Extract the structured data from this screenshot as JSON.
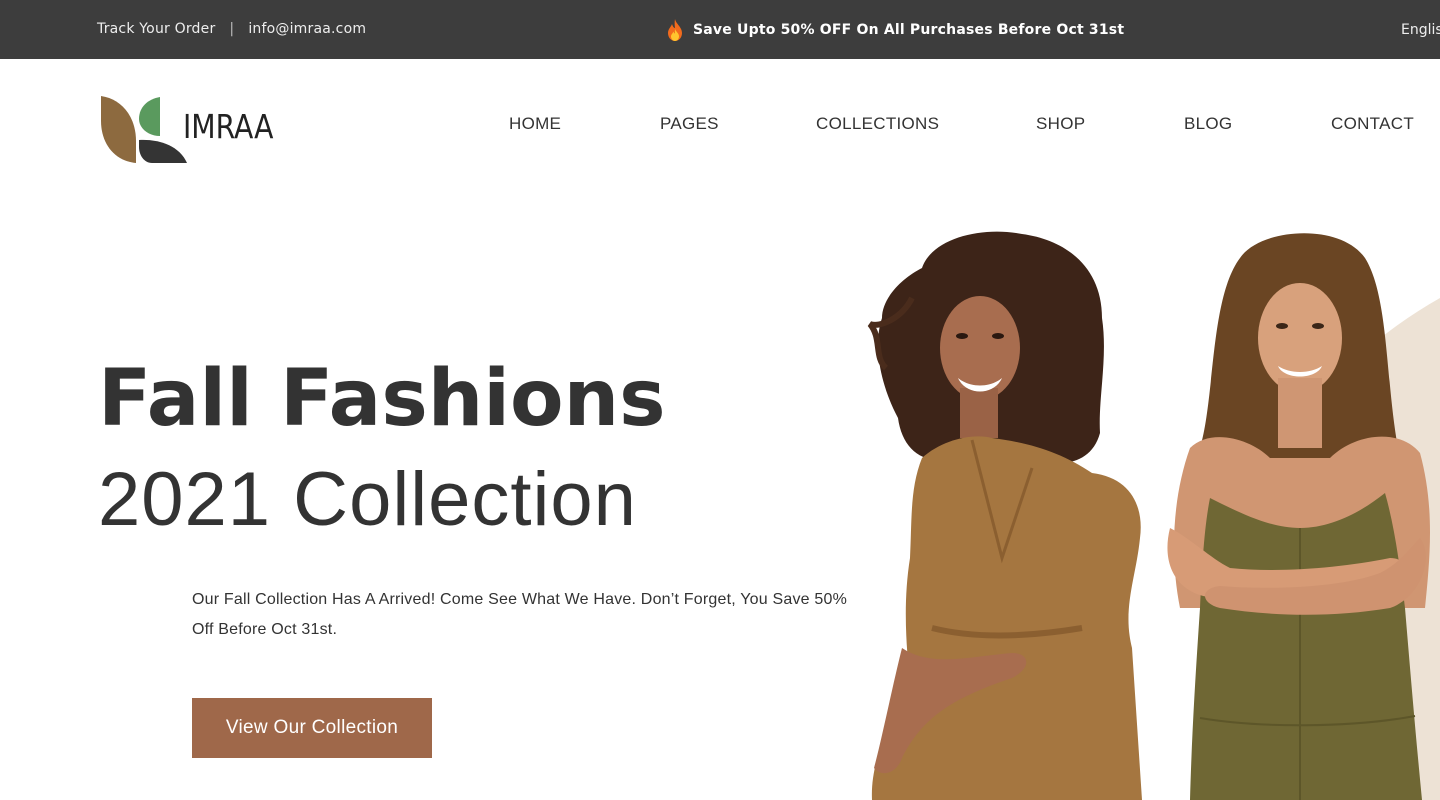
{
  "topbar": {
    "track_order": "Track Your Order",
    "separator": "|",
    "email": "info@imraa.com",
    "promo_icon": "fire-icon",
    "promo_text": "Save Upto 50% OFF On All Purchases Before Oct 31st",
    "language": "English"
  },
  "brand": {
    "name": "IMRAA",
    "colors": {
      "leaf_brown": "#8d6a3f",
      "leaf_green": "#5a9a5e",
      "leaf_dark": "#343434"
    }
  },
  "nav": {
    "items": [
      {
        "label": "HOME"
      },
      {
        "label": "PAGES"
      },
      {
        "label": "COLLECTIONS"
      },
      {
        "label": "SHOP"
      },
      {
        "label": "BLOG"
      },
      {
        "label": "CONTACT"
      }
    ]
  },
  "hero": {
    "title_line1": "Fall Fashions",
    "title_line2": "2021 Collection",
    "description": "Our Fall Collection Has A Arrived! Come See What We Have. Don’t Forget, You Save 50% Off Before Oct 31st.",
    "cta_label": "View Our Collection",
    "images": [
      {
        "alt": "Woman with curly hair in brown wrap dress"
      },
      {
        "alt": "Woman with long hair in olive dress, arms crossed"
      }
    ]
  },
  "colors": {
    "topbar_bg": "#3d3d3d",
    "text_dark": "#333333",
    "cta_bg": "#9f684a",
    "accent_shape": "#ede2d5"
  }
}
